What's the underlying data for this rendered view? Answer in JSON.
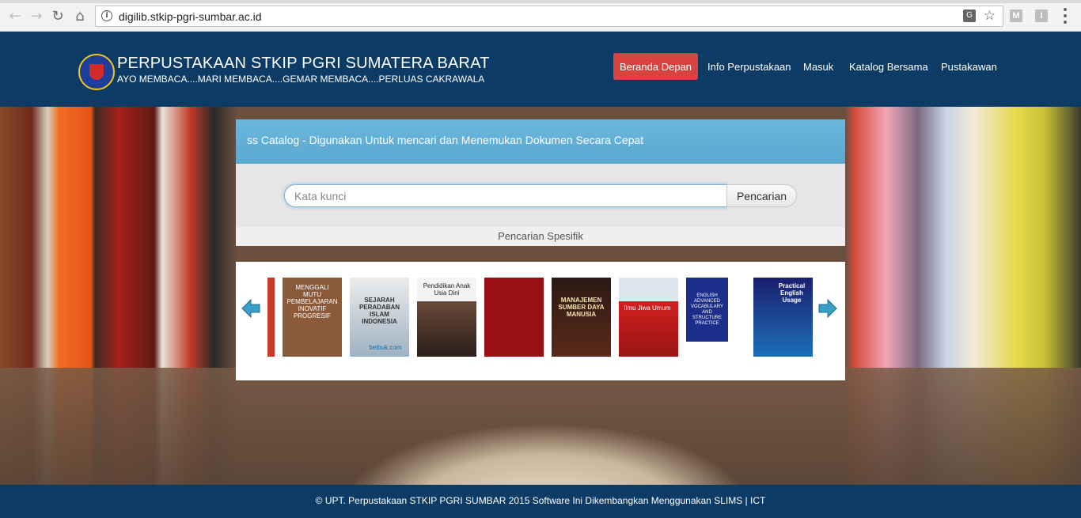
{
  "browser": {
    "url": "digilib.stkip-pgri-sumbar.ac.id",
    "translate_label": "G",
    "ext1_label": "M",
    "ext2_label": "I"
  },
  "site": {
    "title": "PERPUSTAKAAN STKIP PGRI SUMATERA BARAT",
    "tagline": "AYO MEMBACA....MARI MEMBACA....GEMAR MEMBACA....PERLUAS CAKRAWALA"
  },
  "nav": {
    "items": [
      "Beranda Depan",
      "Info Perpustakaan",
      "Masuk",
      "Katalog Bersama",
      "Pustakawan"
    ],
    "active_color": "#d9433f"
  },
  "catalog": {
    "marquee": "ss Catalog - Digunakan Untuk mencari dan Menemukan Dokumen Secara Cepat",
    "search_placeholder": "Kata kunci",
    "search_button": "Pencarian",
    "specific_search": "Pencarian Spesifik"
  },
  "carousel": {
    "covers": [
      {
        "text": ""
      },
      {
        "text": "MENGGALI MUTU PEMBELAJARAN INOVATIF PROGRESIF"
      },
      {
        "text": "SEJARAH PERADABAN ISLAM INDONESIA"
      },
      {
        "text": "Pendidikan Anak Usia Dini"
      },
      {
        "text": ""
      },
      {
        "text": "MANAJEMEN SUMBER DAYA MANUSIA"
      },
      {
        "text": "Ilmu Jiwa Umum"
      },
      {
        "text": "ENGLISH ADVANCED VOCABULARY AND STRUCTURE PRACTICE"
      },
      {
        "text": "Practical English Usage"
      }
    ],
    "cover2_sub": "belbuk.com"
  },
  "footer": {
    "text": "© UPT. Perpustakaan STKIP PGRI SUMBAR 2015 Software Ini Dikembangkan Menggunakan SLIMS | ICT"
  },
  "colors": {
    "header_bg": "#0c3b66",
    "panel_head": "#6cb7dc",
    "arrow": "#3a9fc4"
  }
}
